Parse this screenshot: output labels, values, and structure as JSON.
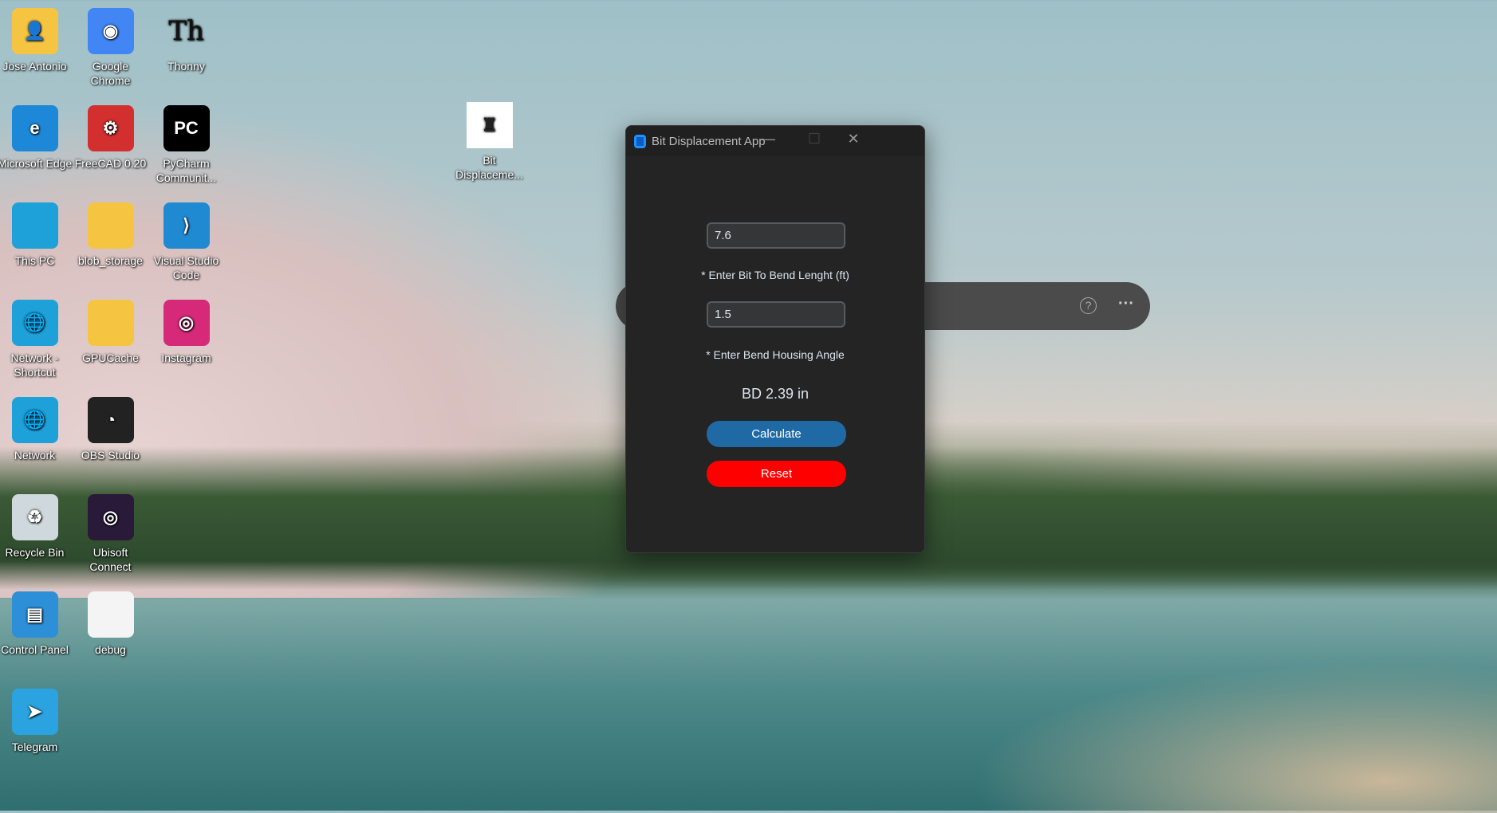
{
  "desktop": {
    "icons": [
      {
        "label": "Jose Antonio",
        "icon": "user-folder-icon",
        "color": "#f5c542",
        "glyph": "👤"
      },
      {
        "label": "Google Chrome",
        "icon": "chrome-icon",
        "color": "#4285f4",
        "glyph": "◉"
      },
      {
        "label": "Thonny",
        "icon": "thonny-icon",
        "color": "transparent",
        "glyph": "Th"
      },
      {
        "label": "Microsoft Edge",
        "icon": "edge-icon",
        "color": "#1e88d8",
        "glyph": "e"
      },
      {
        "label": "FreeCAD 0.20",
        "icon": "freecad-icon",
        "color": "#d32f2f",
        "glyph": "⚙"
      },
      {
        "label": "PyCharm Communit...",
        "icon": "pycharm-icon",
        "color": "#000000",
        "glyph": "PC"
      },
      {
        "label": "This PC",
        "icon": "computer-icon",
        "color": "#1ea0d8",
        "glyph": ""
      },
      {
        "label": "blob_storage",
        "icon": "folder-icon",
        "color": "#f5c542",
        "glyph": ""
      },
      {
        "label": "Visual Studio Code",
        "icon": "vscode-icon",
        "color": "#1f8ad2",
        "glyph": "⟩"
      },
      {
        "label": "Network - Shortcut",
        "icon": "network-icon",
        "color": "#1ea0d8",
        "glyph": "🌐"
      },
      {
        "label": "GPUCache",
        "icon": "folder-icon",
        "color": "#f5c542",
        "glyph": ""
      },
      {
        "label": "Instagram",
        "icon": "instagram-icon",
        "color": "#d6297a",
        "glyph": "◎"
      },
      {
        "label": "Network",
        "icon": "network-icon",
        "color": "#1ea0d8",
        "glyph": "🌐"
      },
      {
        "label": "OBS Studio",
        "icon": "obs-icon",
        "color": "#222222",
        "glyph": "◔"
      },
      {
        "label": "Recycle Bin",
        "icon": "recycle-bin-icon",
        "color": "#cfd8dc",
        "glyph": "♻"
      },
      {
        "label": "Ubisoft Connect",
        "icon": "ubisoft-icon",
        "color": "#2a1a3a",
        "glyph": "◎"
      },
      {
        "label": "Control Panel",
        "icon": "control-panel-icon",
        "color": "#2d8fd8",
        "glyph": "▤"
      },
      {
        "label": "debug",
        "icon": "text-file-icon",
        "color": "#f4f4f4",
        "glyph": ""
      },
      {
        "label": "Telegram",
        "icon": "telegram-icon",
        "color": "#2aa3e0",
        "glyph": "➤"
      },
      {
        "label": "Bit Displaceme...",
        "icon": "drilling-rig-icon",
        "color": "#ffffff",
        "glyph": "♜"
      }
    ]
  },
  "toolbar_pill": {
    "help": "?",
    "more": "···"
  },
  "app": {
    "title": "Bit Displacement App",
    "minimize": "—",
    "maximize": "☐",
    "close": "✕",
    "bit_to_bend": "7.6",
    "bit_to_bend_label": "* Enter Bit To Bend Lenght (ft)",
    "bend_angle": "1.5",
    "bend_angle_label": "* Enter Bend Housing Angle",
    "result": "BD 2.39 in",
    "calculate": "Calculate",
    "reset": "Reset",
    "colors": {
      "calculate": "#1f6aa5",
      "reset": "#ff0000",
      "window": "#242424"
    }
  }
}
